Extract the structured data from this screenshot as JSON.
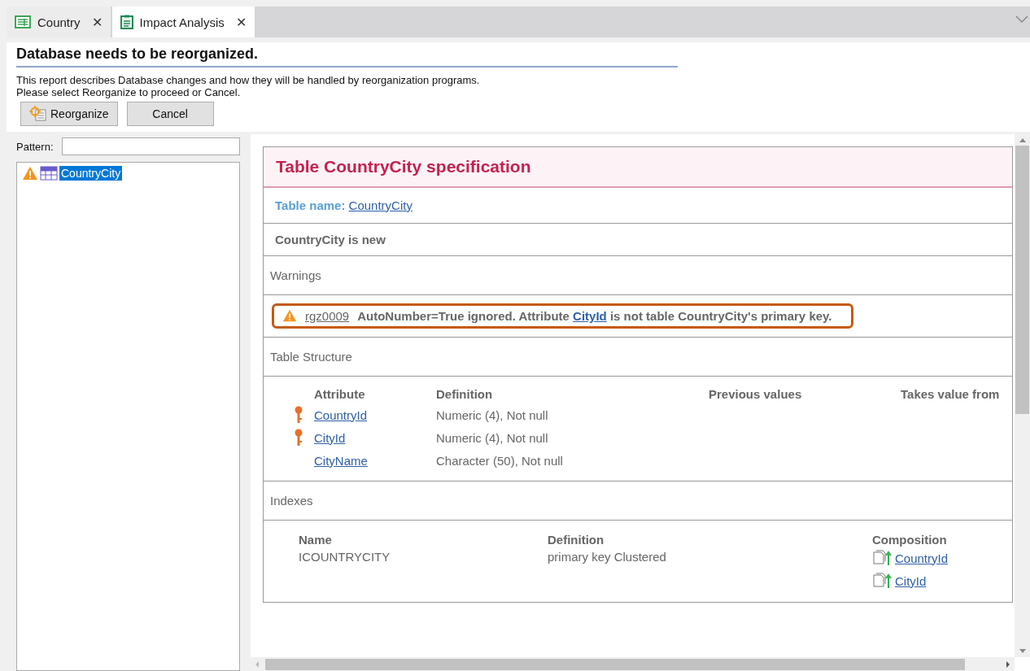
{
  "tabs": [
    {
      "label": "Country",
      "kind": "table",
      "selected": false,
      "close": "✕"
    },
    {
      "label": "Impact Analysis",
      "kind": "report",
      "selected": true,
      "close": "✕"
    }
  ],
  "header": {
    "title": "Database needs to be reorganized.",
    "description": [
      "This report describes Database changes and how they will be handled by reorganization programs.",
      "Please select Reorganize to proceed or Cancel."
    ],
    "buttons": [
      {
        "label": "Reorganize",
        "kind": "icon"
      },
      {
        "label": "Cancel",
        "kind": "plain"
      }
    ]
  },
  "sidebar": {
    "pattern_label": "Pattern:",
    "tree_items": [
      {
        "label": "CountryCity",
        "selected": true,
        "warning": true
      }
    ]
  },
  "spec": {
    "title": "Table CountryCity specification",
    "table_name_label": "Table name:",
    "table_name": "CountryCity",
    "status": "CountryCity is new",
    "warnings": {
      "header": "Warnings",
      "items": [
        {
          "code": "rgz0009",
          "before": "AutoNumber=True ignored. Attribute",
          "link": "CityId",
          "after": "is not table CountryCity's primary key.",
          "highlighted": true
        }
      ]
    },
    "structure": {
      "header": "Table Structure",
      "columns": [
        "Attribute",
        "Definition",
        "Previous values",
        "Takes value from"
      ],
      "rows": [
        {
          "attribute": "CountryId",
          "definition": "Numeric (4), Not null",
          "key": true
        },
        {
          "attribute": "CityId",
          "definition": "Numeric (4), Not null",
          "key": true
        },
        {
          "attribute": "CityName",
          "definition": "Character (50), Not null",
          "key": false
        }
      ]
    },
    "indexes": {
      "header": "Indexes",
      "columns": [
        "Name",
        "Definition",
        "Composition"
      ],
      "rows": [
        {
          "name": "ICOUNTRYCITY",
          "definition": "primary key Clustered",
          "composition": [
            "CountryId",
            "CityId"
          ]
        }
      ]
    }
  }
}
